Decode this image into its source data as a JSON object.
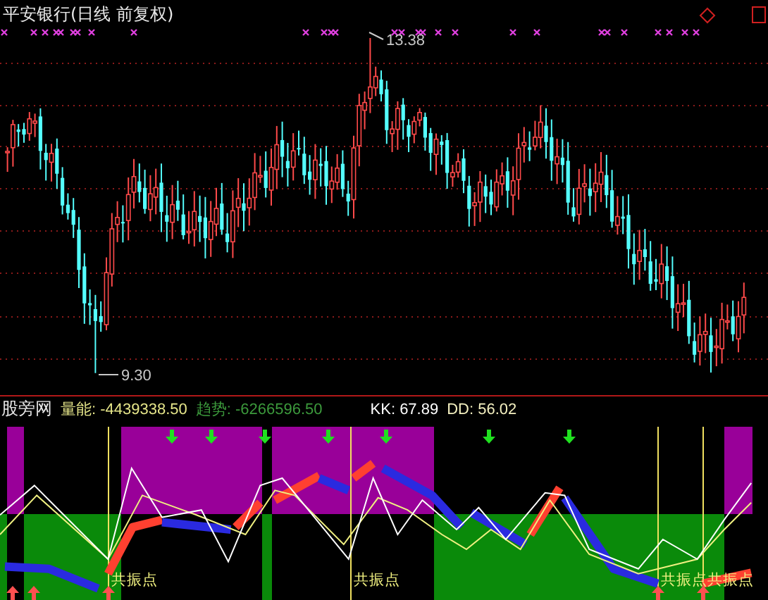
{
  "title": "平安银行(日线 前复权)",
  "price_marks": [
    {
      "kind": "high",
      "label": "13.38"
    },
    {
      "kind": "low",
      "label": "9.30"
    }
  ],
  "indicator": {
    "name": "股旁网",
    "items": [
      {
        "label": "量能:",
        "value": "-4439338.50",
        "color": "#e6e68a"
      },
      {
        "label": "趋势:",
        "value": "-6266596.50",
        "color": "#3c9a3c"
      },
      {
        "label": "KK:",
        "value": "67.89",
        "color": "#ffffff"
      },
      {
        "label": "DD:",
        "value": "56.02",
        "color": "#f4f0c0"
      }
    ]
  },
  "signals": [
    {
      "label": "共振点"
    },
    {
      "label": "共振点"
    },
    {
      "label": "共振点"
    },
    {
      "label": "共振点"
    }
  ]
}
